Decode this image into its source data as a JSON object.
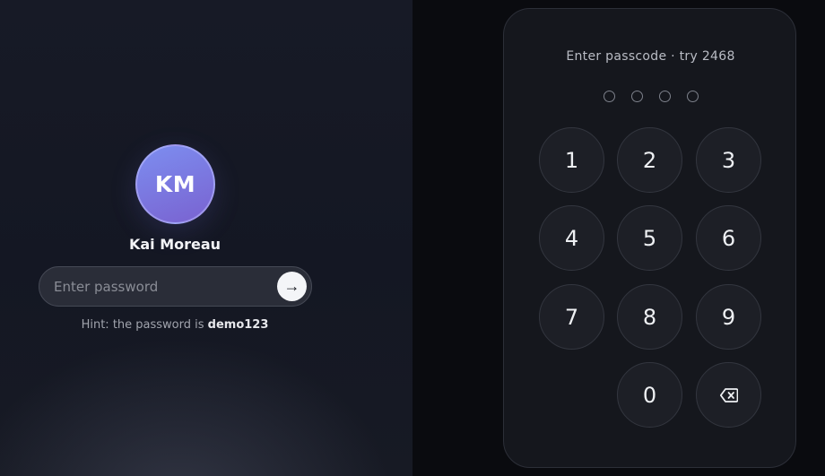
{
  "login": {
    "avatar_initials": "KM",
    "user_name": "Kai Moreau",
    "password_placeholder": "Enter password",
    "password_value": "",
    "submit_icon": "arrow-right-icon",
    "submit_glyph": "→",
    "hint_prefix": "Hint: the password is ",
    "hint_password": "demo123"
  },
  "keypad": {
    "prompt": "Enter passcode · try 2468",
    "passcode_length": 4,
    "entered_digits": 0,
    "keys": [
      "1",
      "2",
      "3",
      "4",
      "5",
      "6",
      "7",
      "8",
      "9",
      "0"
    ],
    "backspace_icon": "backspace-icon"
  },
  "colors": {
    "avatar_gradient_start": "#7c8ef0",
    "avatar_gradient_end": "#7a62d0",
    "left_bg": "#171a26",
    "right_bg": "#0a0b0f",
    "key_bg": "#1d1f26"
  }
}
